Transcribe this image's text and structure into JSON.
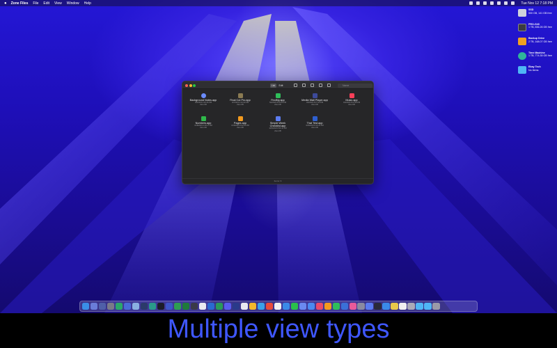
{
  "menubar": {
    "app_name": "Zone Files",
    "menus": [
      "File",
      "Edit",
      "View",
      "Window",
      "Help"
    ],
    "clock": "Tue Nov 12  7:18 PM"
  },
  "drives": [
    {
      "name": "SSD",
      "detail": "500 GB, 141 GB free",
      "color": "#cfd3db"
    },
    {
      "name": "PRO-G40",
      "detail": "1 TB, 836.26 GB free",
      "color": "#3a3a40"
    },
    {
      "name": "Backup Drive",
      "detail": "2 TB, 168.07 GB free",
      "color": "#f0a020"
    },
    {
      "name": "Time Machine",
      "detail": "1 TB, 774.35 GB free",
      "color": "#2fb59a"
    },
    {
      "name": "Ebay Tech",
      "detail": "No Items",
      "color": "#4fb6f5"
    }
  ],
  "window": {
    "view_list": "List",
    "view_edit": "Edit",
    "search_placeholder": "Name",
    "status": "Items: 9",
    "files": [
      {
        "name": "Background Notes.app",
        "date": "3/2/2023 3:26:46 PM",
        "size": "Zero KB",
        "color": "#6b8cff"
      },
      {
        "name": "Final Cut Pro.app",
        "date": "4/7/2023 4:10:33 PM",
        "size": "Zero KB",
        "color": "#8a7a52"
      },
      {
        "name": "FindMy.app",
        "date": "5/2/2023 8:25:09 PM",
        "size": "Zero KB",
        "color": "#2fbf5a"
      },
      {
        "name": "Media Wall Player.app",
        "date": "3/3/2023 8:37:40 PM",
        "size": "Zero KB",
        "color": "#3d4a9a"
      },
      {
        "name": "Music.app",
        "date": "4/3/2023 8:16:38 PM",
        "size": "Zero KB",
        "color": "#fa3f58"
      },
      {
        "name": "Numbers.app",
        "date": "3/18/2023 4:16:17 PM",
        "size": "Zero KB",
        "color": "#2fb94a"
      },
      {
        "name": "Pages.app",
        "date": "3/19/2023 5:02:00 PM",
        "size": "Zero KB",
        "color": "#f39a1e"
      },
      {
        "name": "Simple Week Checklist.app",
        "date": "10/5/2023 8:36:11 PM",
        "size": "Zero KB",
        "color": "#5c7cf0"
      },
      {
        "name": "That Test.app",
        "date": "10/8/2023 8:16:12 PM",
        "size": "Zero KB",
        "color": "#2f5fd0"
      }
    ]
  },
  "dock": {
    "colors": [
      "#3a8ee6",
      "#6a7cd8",
      "#4f5fa8",
      "#7a7a88",
      "#2aa86a",
      "#4a6ad8",
      "#8ab0e0",
      "#2b3a6a",
      "#2a9a8a",
      "#1c1c28",
      "#3d55c8",
      "#2e9e52",
      "#1f7a3a",
      "#3a3a48",
      "#eaeaf0",
      "#2a6ad0",
      "#2a9a5a",
      "#5a5af0",
      "#2a3a8a",
      "#e8e8f0",
      "#f3b82a",
      "#3aa0e8",
      "#e84a3a",
      "#f0f0f0",
      "#3a8ae8",
      "#2ac04a",
      "#6a8af0",
      "#4a8af0",
      "#e84a6a",
      "#f39a1e",
      "#2fbf5a",
      "#3a70d8",
      "#e85a9a",
      "#8a8aa0",
      "#5a7af0",
      "#2a2a3a",
      "#3a8ae8",
      "#e8c84a",
      "#f0f0f0",
      "#aaaab8",
      "#4fb6f5",
      "#4fb6f5",
      "#9a9aa8"
    ]
  },
  "caption": "Multiple view types"
}
